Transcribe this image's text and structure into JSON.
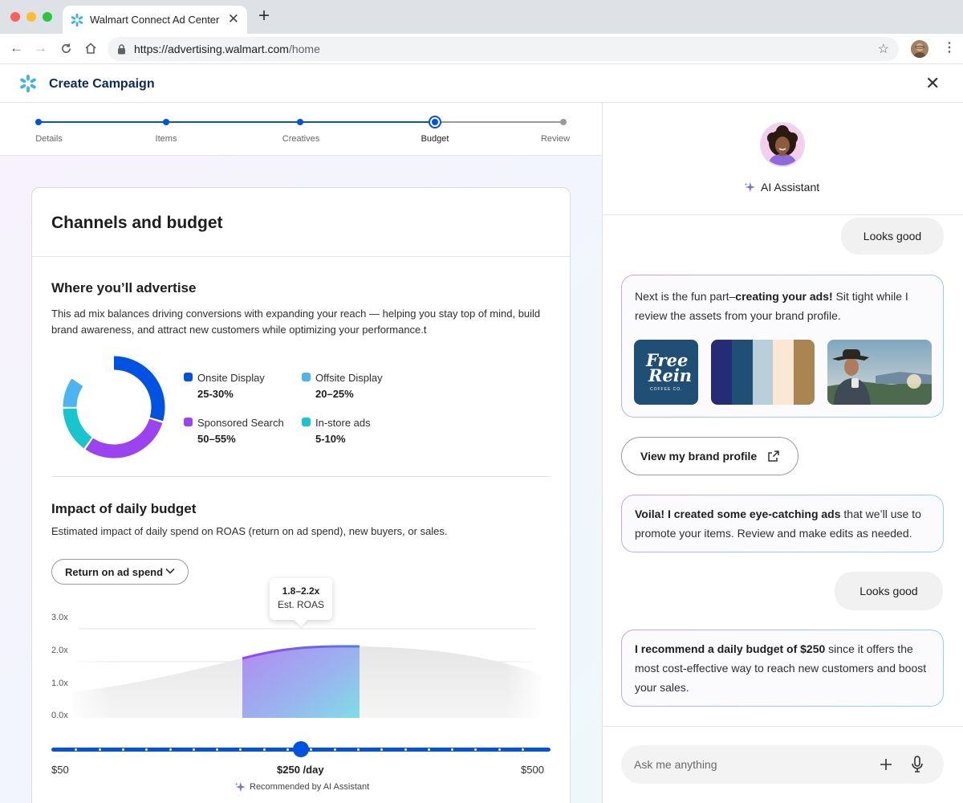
{
  "browser": {
    "tab_title": "Walmart Connect Ad Center",
    "tab_close": "✕",
    "new_tab": "+",
    "url_host": "https://advertising.walmart.com",
    "url_path": "/home"
  },
  "app": {
    "title": "Create Campaign",
    "close": "✕"
  },
  "stepper": {
    "steps": [
      "Details",
      "Items",
      "Creatives",
      "Budget",
      "Review"
    ],
    "current": "Budget"
  },
  "card": {
    "title": "Channels and budget",
    "advertise": {
      "title": "Where you’ll advertise",
      "description": "This ad mix balances driving conversions with expanding your reach — helping you stay top of mind, build brand awareness, and attract new customers while optimizing your performance.t",
      "channels": [
        {
          "name": "Onsite Display",
          "range": "25-30%",
          "color": "#0053e2",
          "share": 0.3
        },
        {
          "name": "Offsite Display",
          "range": "20–25%",
          "color": "#4cb4f0",
          "share": 0.1
        },
        {
          "name": "Sponsored Search",
          "range": "50–55%",
          "color": "#9b43f0",
          "share": 0.3
        },
        {
          "name": "In-store ads",
          "range": "5-10%",
          "color": "#16c6cf",
          "share": 0.15
        }
      ]
    },
    "budget": {
      "title": "Impact of daily budget",
      "description": "Estimated impact of daily spend on ROAS (return on ad spend), new buyers, or  sales.",
      "metric_select": "Return on ad spend",
      "y_ticks": [
        "3.0x",
        "2.0x",
        "1.0x",
        "0.0x"
      ],
      "tooltip_value": "1.8–2.2x",
      "tooltip_label": "Est. ROAS",
      "slider_min": "$50",
      "slider_max": "$500",
      "slider_value": "$250 /day",
      "slider_position": 0.5,
      "recommended": "Recommended by AI Assistant"
    }
  },
  "assistant": {
    "name": "AI Assistant",
    "messages": {
      "user_1": "Looks good",
      "ai_1_pre": "Next is the fun part–",
      "ai_1_bold": "creating your ads!",
      "ai_1_post": " Sit tight while I review the assets from your brand profile.",
      "brand_logo_line1": "Free",
      "brand_logo_line2": "Rein",
      "brand_logo_sub": "COFFEE CO.",
      "palette": [
        "#262b75",
        "#1f4f74",
        "#b9cfd9",
        "#fbe8d4",
        "#aa8551"
      ],
      "view_brand_profile": "View my brand profile",
      "ai_2_bold": "Voila! I created some eye-catching ads",
      "ai_2_rest": " that we’ll use to promote your items. Review and make edits as needed.",
      "user_2": "Looks good",
      "ai_3_bold": "I recommend a daily budget of $250",
      "ai_3_rest": " since it offers the most cost-effective way to reach new customers and boost your sales."
    },
    "composer_placeholder": "Ask me anything"
  }
}
